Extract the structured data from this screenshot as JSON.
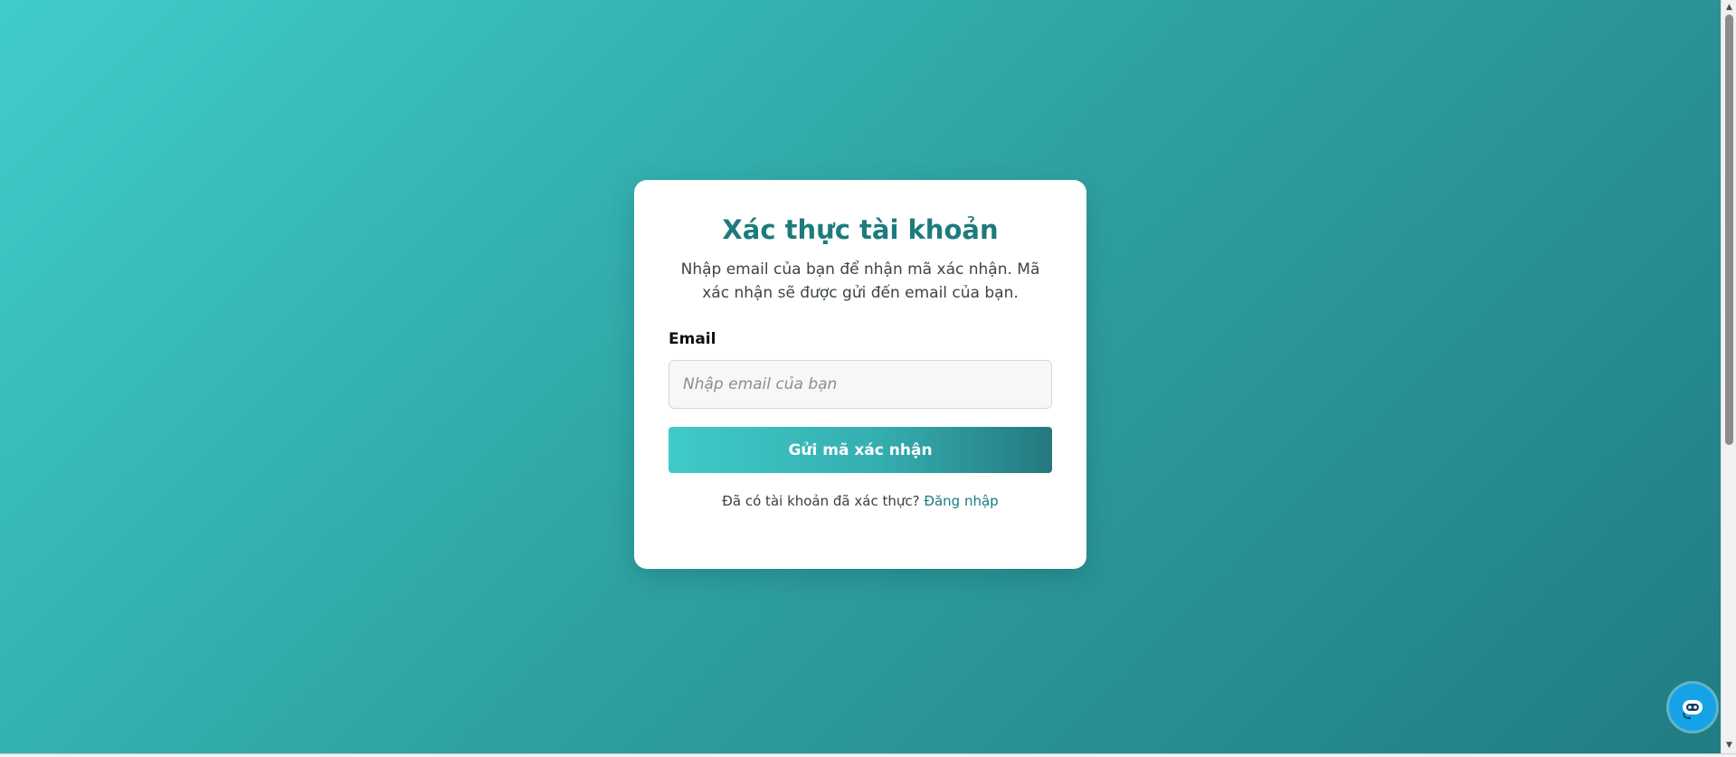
{
  "page": {
    "background_gradient": [
      "#40cccb",
      "#217c83"
    ]
  },
  "card": {
    "title": "Xác thực tài khoản",
    "description": "Nhập email của bạn để nhận mã xác nhận. Mã xác nhận sẽ được gửi đến email của bạn.",
    "email_label": "Email",
    "email_value": "",
    "email_placeholder": "Nhập email của bạn",
    "submit_label": "Gửi mã xác nhận",
    "footer_text": "Đã có tài khoản đã xác thực?",
    "login_link": "Đăng nhập"
  },
  "chat_widget": {
    "icon": "chatbot-icon",
    "color": "#16a2e6"
  },
  "colors": {
    "accent": "#1e7b7d",
    "button_start": "#3fcaca",
    "button_end": "#23787e"
  }
}
